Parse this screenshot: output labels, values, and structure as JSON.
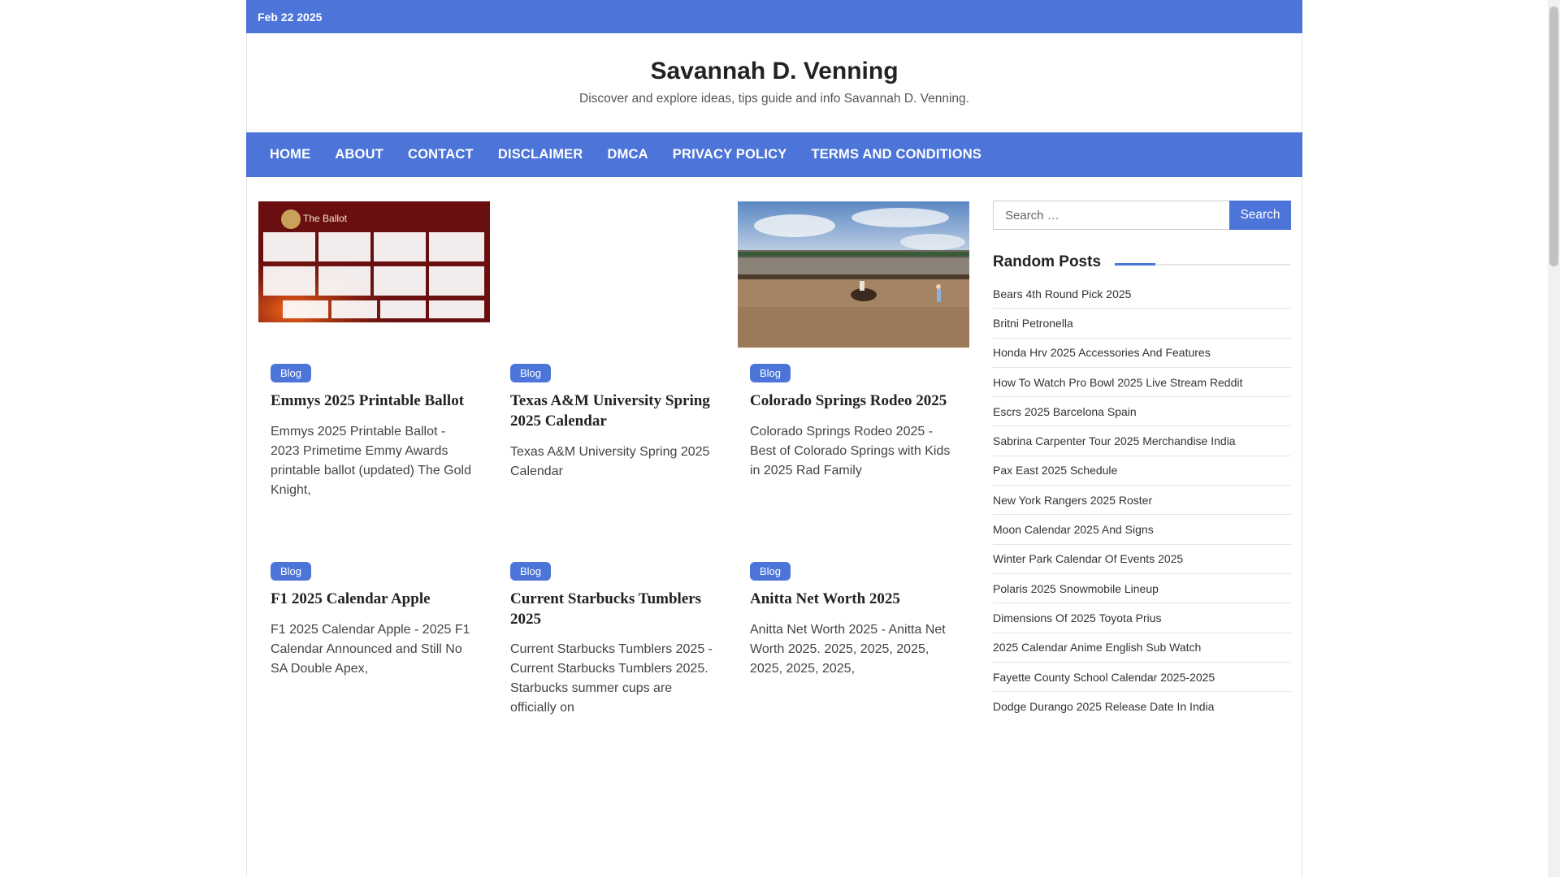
{
  "topbar": {
    "date": "Feb 22 2025"
  },
  "header": {
    "title": "Savannah D. Venning",
    "description": "Discover and explore ideas, tips guide and info Savannah D. Venning."
  },
  "nav": {
    "items": [
      "HOME",
      "ABOUT",
      "CONTACT",
      "DISCLAIMER",
      "DMCA",
      "PRIVACY POLICY",
      "TERMS AND CONDITIONS"
    ]
  },
  "posts": [
    {
      "category": "Blog",
      "title": "Emmys 2025 Printable Ballot",
      "excerpt": "Emmys 2025 Printable Ballot - 2023 Primetime Emmy Awards printable ballot (updated) The Gold Knight,",
      "image": "emmy-ballot-thumbnail"
    },
    {
      "category": "Blog",
      "title": "Texas A&M University Spring 2025 Calendar",
      "excerpt": "Texas A&M University Spring 2025 Calendar",
      "image": ""
    },
    {
      "category": "Blog",
      "title": "Colorado Springs Rodeo 2025",
      "excerpt": "Colorado Springs Rodeo 2025 - Best of Colorado Springs with Kids in 2025 Rad Family",
      "image": "rodeo-arena-thumbnail"
    },
    {
      "category": "Blog",
      "title": "F1 2025 Calendar Apple",
      "excerpt": "F1 2025 Calendar Apple - 2025 F1 Calendar Announced and Still No SA Double Apex,",
      "image": ""
    },
    {
      "category": "Blog",
      "title": "Current Starbucks Tumblers 2025",
      "excerpt": "Current Starbucks Tumblers 2025 - Current Starbucks Tumblers 2025. Starbucks summer cups are officially on",
      "image": ""
    },
    {
      "category": "Blog",
      "title": "Anitta Net Worth 2025",
      "excerpt": "Anitta Net Worth 2025 - Anitta Net Worth 2025. 2025, 2025, 2025, 2025, 2025, 2025,",
      "image": ""
    }
  ],
  "emmy_thumb": {
    "heading": "The Ballot"
  },
  "sidebar": {
    "search_placeholder": "Search …",
    "search_button": "Search",
    "widget_title": "Random Posts",
    "random_posts": [
      "Bears 4th Round Pick 2025",
      "Britni Petronella",
      "Honda Hrv 2025 Accessories And Features",
      "How To Watch Pro Bowl 2025 Live Stream Reddit",
      "Escrs 2025 Barcelona Spain",
      "Sabrina Carpenter Tour 2025 Merchandise India",
      "Pax East 2025 Schedule",
      "New York Rangers 2025 Roster",
      "Moon Calendar 2025 And Signs",
      "Winter Park Calendar Of Events 2025",
      "Polaris 2025 Snowmobile Lineup",
      "Dimensions Of 2025 Toyota Prius",
      "2025 Calendar Anime English Sub Watch",
      "Fayette County School Calendar 2025-2025",
      "Dodge Durango 2025 Release Date In India"
    ]
  },
  "colors": {
    "accent": "#4c74d9"
  }
}
